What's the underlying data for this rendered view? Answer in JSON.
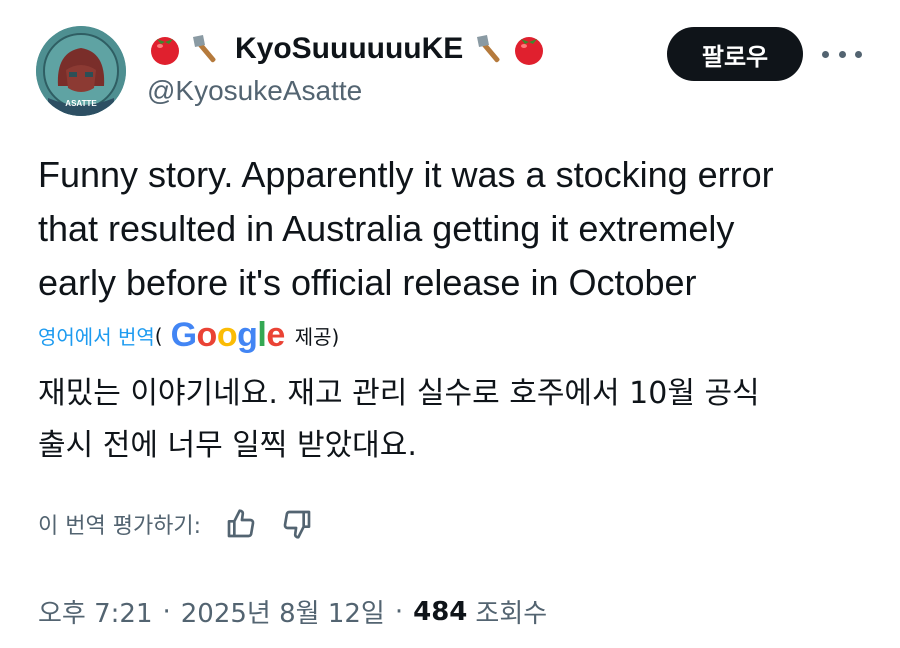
{
  "author": {
    "display_name": "KyoSuuuuuuKE",
    "handle": "@KyosukeAsatte",
    "avatar_text": "ASATTE",
    "emoji_left": [
      "tomato",
      "axe"
    ],
    "emoji_right": [
      "axe",
      "tomato"
    ]
  },
  "actions": {
    "follow_label": "팔로우",
    "more_icon": "more-horizontal-icon"
  },
  "tweet": {
    "text_lines": [
      "Funny story. Apparently it was a stocking error",
      "that resulted in Australia getting it extremely",
      "early before it's official release in October"
    ]
  },
  "translation": {
    "link_label": "영어에서 번역",
    "paren_open": "(",
    "provider": "Google",
    "provided_label": "제공)",
    "text_lines": [
      "재밌는 이야기네요. 재고 관리 실수로 호주에서 10월 공식",
      "출시 전에 너무 일찍 받았대요."
    ],
    "rate_label": "이 번역 평가하기:"
  },
  "meta": {
    "time": "오후 7:21",
    "separator": "·",
    "date": "2025년 8월 12일",
    "views_count": "484",
    "views_label": "조회수"
  },
  "colors": {
    "text": "#0f1419",
    "secondary": "#536471",
    "link": "#1d9bf0",
    "google_blue": "#4285F4",
    "google_red": "#EA4335",
    "google_yellow": "#FBBC05",
    "google_green": "#34A853"
  }
}
